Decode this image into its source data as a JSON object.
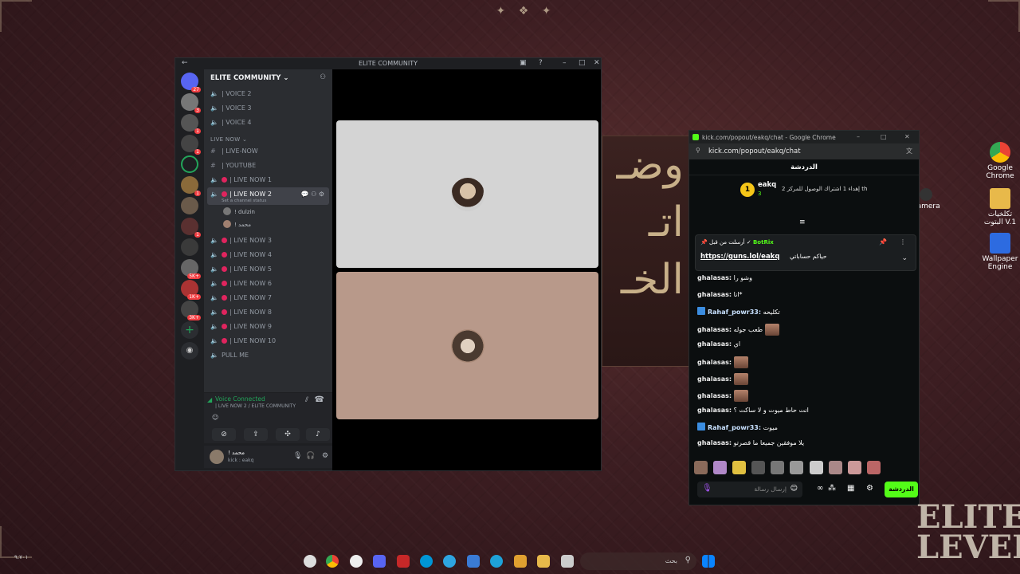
{
  "discord": {
    "window_title": "ELITE COMMUNITY",
    "guild_name": "ELITE COMMUNITY",
    "server_badges": [
      "27",
      "3",
      "1",
      "1",
      "1",
      "1",
      "5K+",
      "1K+",
      "3K+"
    ],
    "voice_top": [
      "| VOICE 2",
      "| VOICE 3",
      "| VOICE 4"
    ],
    "category_live": "LIVE NOW",
    "text_channels": [
      "| LIVE-NOW",
      "| YOUTUBE"
    ],
    "live_channels_a": [
      "| LIVE NOW 1"
    ],
    "active_channel": "| LIVE NOW 2",
    "active_status": "Set a channel status",
    "vc_users": [
      "! dulzin",
      "! محمد"
    ],
    "live_channels_b": [
      "| LIVE NOW 3",
      "| LIVE NOW 4",
      "| LIVE NOW 5",
      "| LIVE NOW 6",
      "| LIVE NOW 7",
      "| LIVE NOW 8",
      "| LIVE NOW 9",
      "| LIVE NOW 10"
    ],
    "pull_me": "PULL ME",
    "voice_connected": "Voice Connected",
    "voice_sub": "| LIVE NOW 2 / ELITE COMMUNITY",
    "user_name": "! محمد",
    "user_status": "kick : eakq"
  },
  "background": {
    "art_text": [
      "وضـ",
      "اتـ",
      "الخـ"
    ],
    "elite_logo": "ELITE LEVEL"
  },
  "desktop_icons": [
    "Google Chrome",
    "تكلخيات البتوت V.1",
    "Wallpaper Engine",
    "Camera"
  ],
  "kick": {
    "window_title": "kick.com/popout/eakq/chat - Google Chrome",
    "url": "kick.com/popout/eakq/chat",
    "header": "الدردشة",
    "gift_badge": "1",
    "gift_user": "eakq",
    "gift_count": "3",
    "gift_text": "إهداء 1 اشتراك الوصول للمركز 2 th",
    "pin_header": "أرسلت من قبل",
    "pin_bot": "BotRix",
    "pin_link": "https://guns.lol/eakq",
    "pin_msg": "حياكم حساباتي",
    "messages": [
      {
        "user": "ghalasas:",
        "text": "وشو را"
      },
      {
        "user": "ghalasas:",
        "text": "انا*"
      },
      {
        "user": "Rahaf_powr33:",
        "text": "تكليحه"
      },
      {
        "user": "ghalasas:",
        "text": "طعب جوله"
      },
      {
        "user": "ghalasas:",
        "text": "اي"
      },
      {
        "user": "ghalasas:",
        "text": ""
      },
      {
        "user": "ghalasas:",
        "text": ""
      },
      {
        "user": "ghalasas:",
        "text": ""
      },
      {
        "user": "ghalasas:",
        "text": "انت حاط ميوت و لا ساكت ؟"
      },
      {
        "user": "Rahaf_powr33:",
        "text": "ميوت"
      },
      {
        "user": "ghalasas:",
        "text": "يلا موفقين جميعا ما قصرتو"
      }
    ],
    "input_placeholder": "إرسال رسالة",
    "send_label": "الدردشة"
  },
  "taskbar": {
    "search_text": "بحث",
    "clock": "٩:٧٠١"
  }
}
